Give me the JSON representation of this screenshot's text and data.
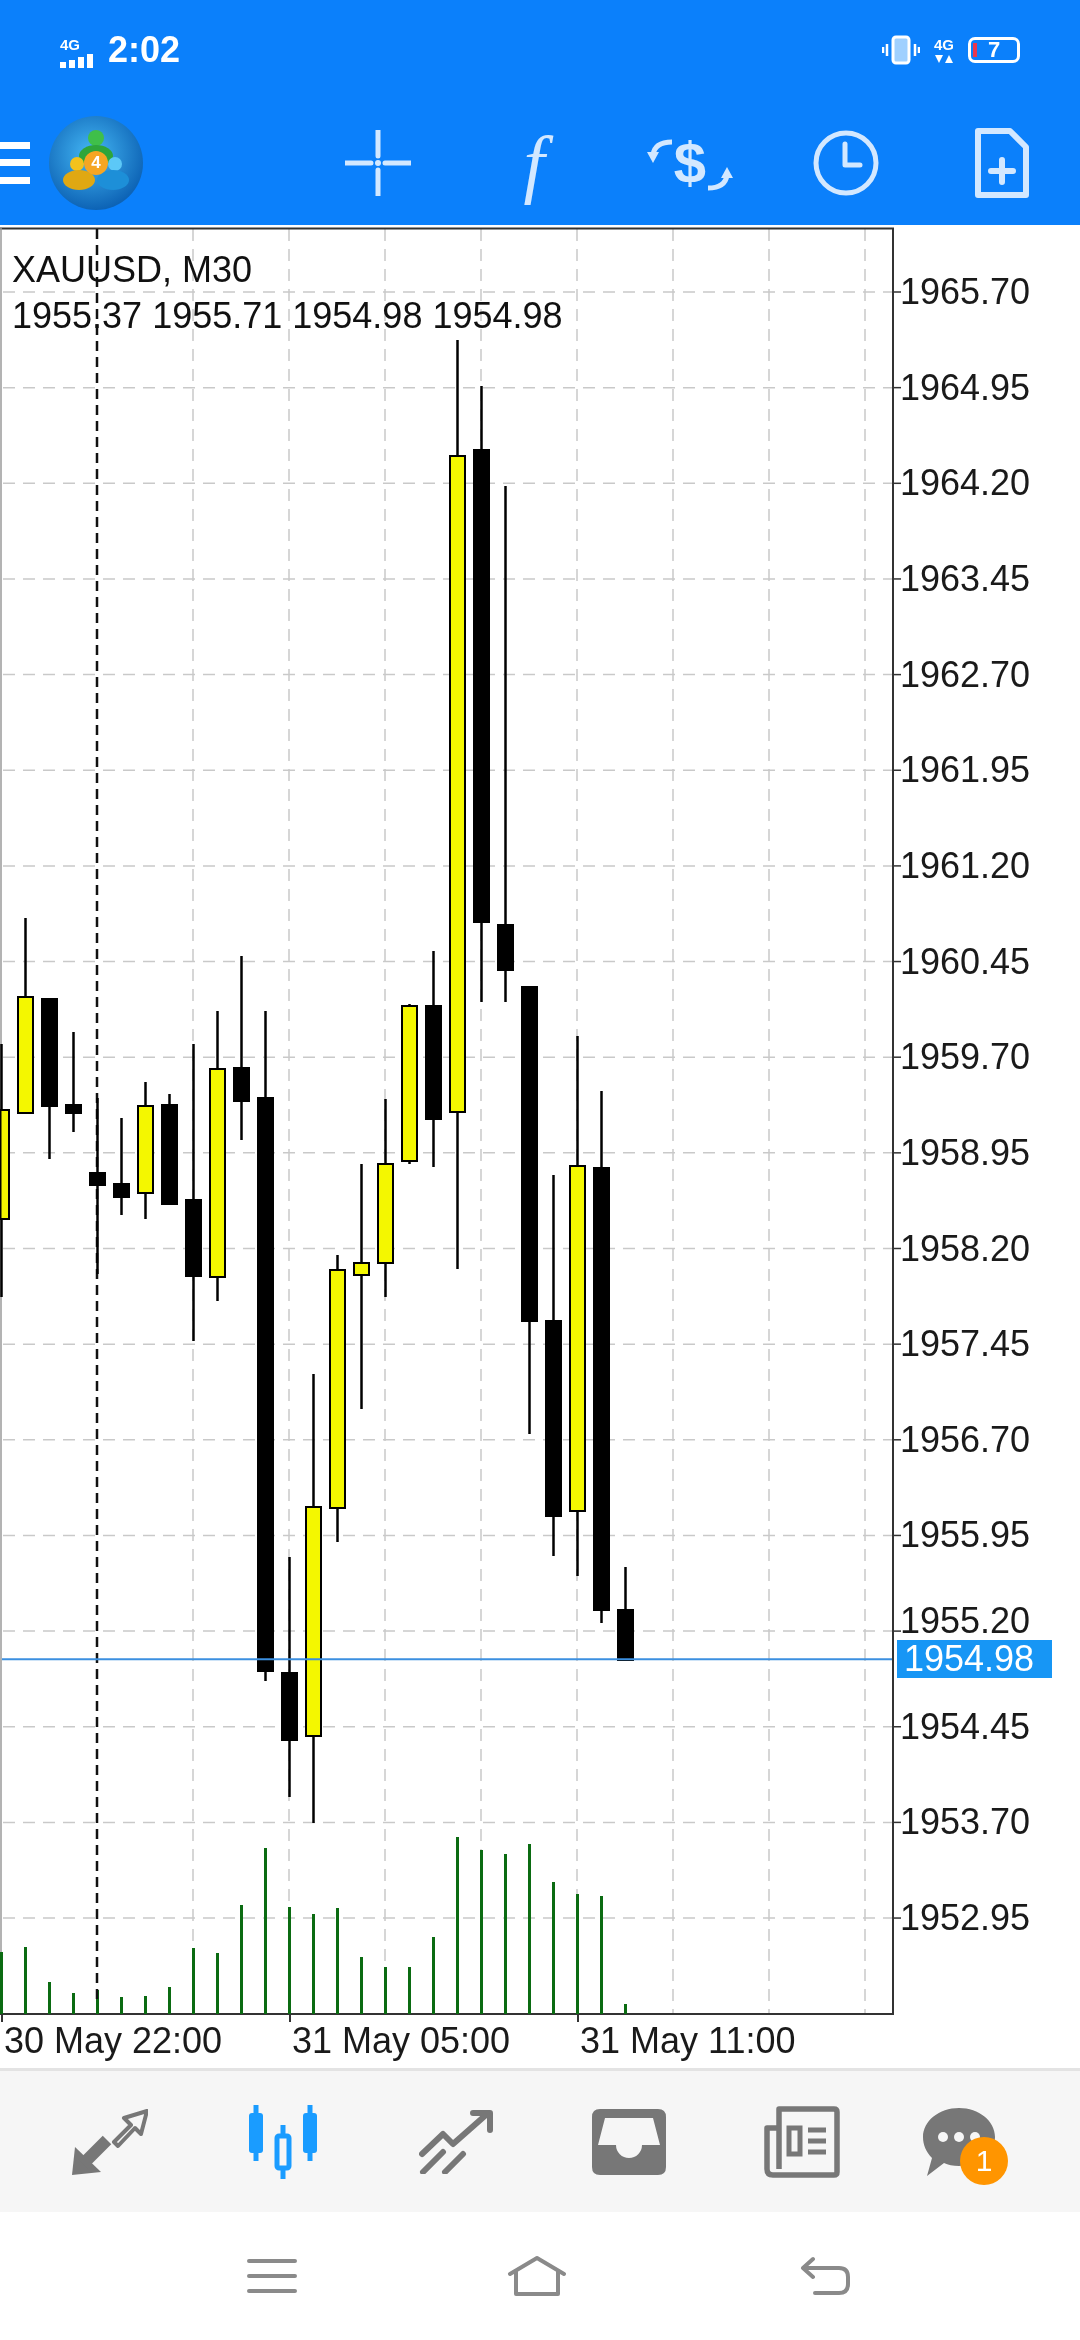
{
  "status_bar": {
    "network_left": "4G",
    "time": "2:02",
    "network_right": "4G",
    "battery": "7"
  },
  "toolbar": {
    "logo_digit": "4",
    "buttons": [
      {
        "kind": "crosshair"
      },
      {
        "kind": "indicators",
        "glyph": "f"
      },
      {
        "kind": "trade",
        "glyph": "$"
      },
      {
        "kind": "timeframe"
      },
      {
        "kind": "new-order"
      }
    ]
  },
  "chart": {
    "symbol": "XAUUSD, M30",
    "ohlc": "1955.37 1955.71 1954.98 1954.98",
    "price_labels": [
      "1965.70",
      "1964.95",
      "1964.20",
      "1963.45",
      "1962.70",
      "1961.95",
      "1961.20",
      "1960.45",
      "1959.70",
      "1958.95",
      "1958.20",
      "1957.45",
      "1956.70",
      "1955.95",
      "1955.20",
      "1954.45",
      "1953.70",
      "1952.95"
    ],
    "current_price": "1954.98",
    "time_labels": [
      "30 May 22:00",
      "31 May 05:00",
      "31 May 11:00"
    ]
  },
  "bottom_nav": [
    {
      "kind": "quotes",
      "selected": false
    },
    {
      "kind": "chart",
      "selected": true
    },
    {
      "kind": "trade",
      "selected": false
    },
    {
      "kind": "history",
      "selected": false
    },
    {
      "kind": "news",
      "selected": false
    },
    {
      "kind": "chat",
      "selected": false,
      "badge": "1"
    }
  ]
}
